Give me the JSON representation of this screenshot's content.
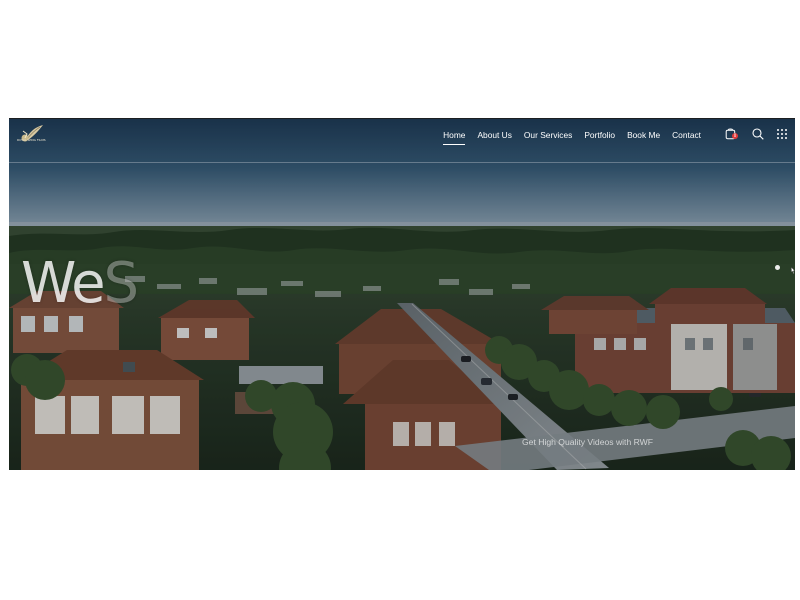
{
  "brand": {
    "logo_text": "ROYAL WING FILMS",
    "logo_icon": "feather-logo-icon",
    "accent_color": "#e23a3a"
  },
  "nav": {
    "items": [
      {
        "label": "Home",
        "active": true
      },
      {
        "label": "About Us",
        "active": false
      },
      {
        "label": "Our Services",
        "active": false
      },
      {
        "label": "Portfolio",
        "active": false
      },
      {
        "label": "Book Me",
        "active": false
      },
      {
        "label": "Contact",
        "active": false
      }
    ]
  },
  "actions": {
    "cart_icon": "cart-icon",
    "cart_count": "0",
    "search_icon": "search-icon",
    "menu_icon": "grid-menu-icon"
  },
  "hero": {
    "headline_visible": "We",
    "headline_partial": "S",
    "subtext": "Get High Quality Videos with RWF",
    "background_description": "aerial-suburb-photo",
    "slider_dot_icon": "slider-dot-icon"
  }
}
